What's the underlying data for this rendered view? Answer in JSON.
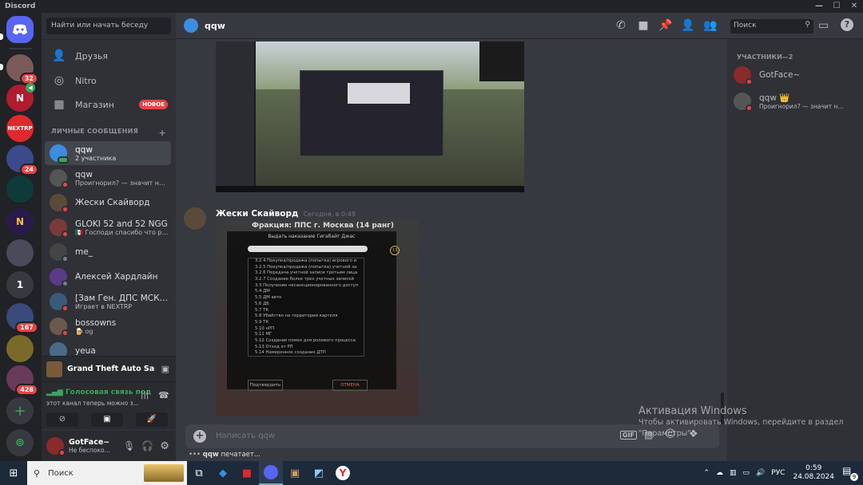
{
  "window": {
    "title": "Discord",
    "controls": [
      "—",
      "☐",
      "✕"
    ]
  },
  "servers": [
    {
      "name": "home",
      "badge": ""
    },
    {
      "name": "srv-1",
      "badge": "32"
    },
    {
      "name": "srv-2",
      "badge": ""
    },
    {
      "name": "srv-nextrp",
      "label": "NEXTRP",
      "badge": ""
    },
    {
      "name": "srv-4",
      "badge": "24"
    },
    {
      "name": "srv-5",
      "badge": ""
    },
    {
      "name": "srv-6",
      "badge": ""
    },
    {
      "name": "srv-7",
      "badge": ""
    },
    {
      "name": "srv-8",
      "label": "1",
      "badge": ""
    },
    {
      "name": "srv-9",
      "badge": "167"
    },
    {
      "name": "srv-10",
      "badge": ""
    },
    {
      "name": "srv-11",
      "badge": "428"
    }
  ],
  "sidebar": {
    "search_placeholder": "Найти или начать беседу",
    "nav": [
      {
        "label": "Друзья"
      },
      {
        "label": "Nitro"
      },
      {
        "label": "Магазин",
        "tag": "НОВОЕ"
      }
    ],
    "dm_header": "ЛИЧНЫЕ СООБЩЕНИЯ",
    "dm_add": "+",
    "dms": [
      {
        "name": "qqw",
        "sub": "2 участника",
        "color": "#3ba55c"
      },
      {
        "name": "qqw",
        "sub": "Проигнорил? — значит н...",
        "color": "#555"
      },
      {
        "name": "Жески Скайворд",
        "sub": "",
        "color": "#5a4a3a"
      },
      {
        "name": "GLOKI 52 and 52 NGG",
        "sub": "🇲🇽 Господи спасибо что ред...",
        "color": "#7a3a3a"
      },
      {
        "name": "me_",
        "sub": "",
        "color": "#444"
      },
      {
        "name": "Алексей Хардлайн",
        "sub": "",
        "color": "#5b3a8a"
      },
      {
        "name": "[Зам Ген. ДПС МСК] ...",
        "sub": "Играет в NEXTRP",
        "color": "#3a5a7a"
      },
      {
        "name": "bossowns",
        "sub": "🍺 og",
        "color": "#6a5a4a"
      },
      {
        "name": "yeua",
        "sub": "",
        "color": "#4a6a8a"
      }
    ]
  },
  "activity": {
    "game": "Grand Theft Auto San ..."
  },
  "voice": {
    "title": "Голосовая связь под",
    "sub": "этот канал теперь можно з..."
  },
  "user": {
    "name": "GotFace~",
    "status": "Не беспоко..."
  },
  "channel": {
    "name": "qqw"
  },
  "toolbar": {
    "search_placeholder": "Поиск"
  },
  "messages": [
    {
      "author": "Жески Скайворд",
      "time": "Сегодня, в 0:49"
    }
  ],
  "embed": {
    "title": "Фракция: ППС г. Москва (14 ранг)",
    "subtitle": "Выдать наказание Гигабайт Джас",
    "lines": [
      "3.2.4 Покупка/продажа (попытка) игрового и",
      "3.2.5 Покупка/продажа (попытка) учетной за",
      "3.2.6 Передача учетной записи третьим лица",
      "3.2.7 Создание более трех учетных записей",
      "3.3 Получение несанкционированного доступ",
      "5.4 ДМ",
      "5.5 ДМ авто",
      "5.6 ДБ",
      "5.7 ТК",
      "5.8 Убийство на территории картеля",
      "5.9 ТК",
      "5.10 нРП",
      "5.11 МГ",
      "5.12 Создание помех для ролевого процесса",
      "5.13 Отход от РП",
      "5.14 Намеренное создание ДТП"
    ],
    "btn_ok": "Подтвердить",
    "btn_cancel": "ОТМЕНА",
    "badge": "13"
  },
  "composer": {
    "placeholder": "Написать qqw"
  },
  "typing": {
    "user": "qqw",
    "text": "печатает..."
  },
  "members": {
    "header": "УЧАСТНИКИ—2",
    "list": [
      {
        "name": "GotFace~",
        "sub": ""
      },
      {
        "name": "qqw 👑",
        "sub": "Проигнорил? — значит н..."
      }
    ]
  },
  "watermark": {
    "title": "Активация Windows",
    "sub": "Чтобы активировать Windows, перейдите в раздел \"Параметры\"."
  },
  "taskbar": {
    "search": "Поиск",
    "lang": "РУС",
    "time": "0:59",
    "date": "24.08.2024",
    "notif": "9"
  }
}
